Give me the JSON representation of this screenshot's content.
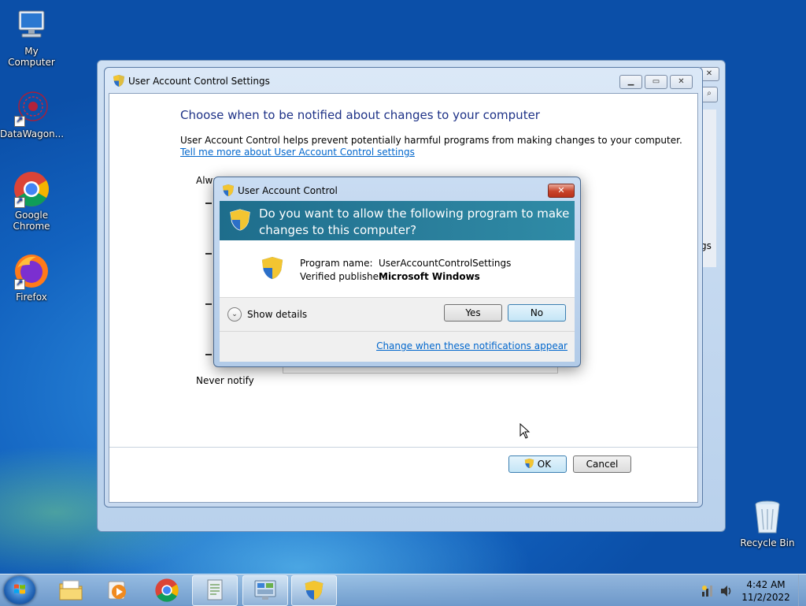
{
  "desktop": {
    "icons": [
      {
        "label": "My Computer"
      },
      {
        "label": "DataWagon..."
      },
      {
        "label": "Google Chrome"
      },
      {
        "label": "Firefox"
      },
      {
        "label": "Recycle Bin"
      }
    ]
  },
  "uac_settings": {
    "title": "User Account Control Settings",
    "heading": "Choose when to be notified about changes to your computer",
    "description": "User Account Control helps prevent potentially harmful programs from making changes to your computer.",
    "link": "Tell me more about User Account Control settings",
    "always_label": "Alwa",
    "never_label": "Never notify",
    "ok_label": "OK",
    "cancel_label": "Cancel",
    "behind_fragment": "gs"
  },
  "uac_prompt": {
    "title": "User Account Control",
    "question": "Do you want to allow the following program to make changes to this computer?",
    "program_name_label": "Program name:",
    "program_name_value": "UserAccountControlSettings",
    "publisher_label": "Verified publisher:",
    "publisher_value": "Microsoft Windows",
    "show_details": "Show details",
    "yes_label": "Yes",
    "no_label": "No",
    "change_link": "Change when these notifications appear"
  },
  "taskbar": {
    "time": "4:42 AM",
    "date": "11/2/2022"
  },
  "colors": {
    "banner": "#1e6d8c",
    "link": "#0066cc",
    "heading": "#1e3287"
  }
}
